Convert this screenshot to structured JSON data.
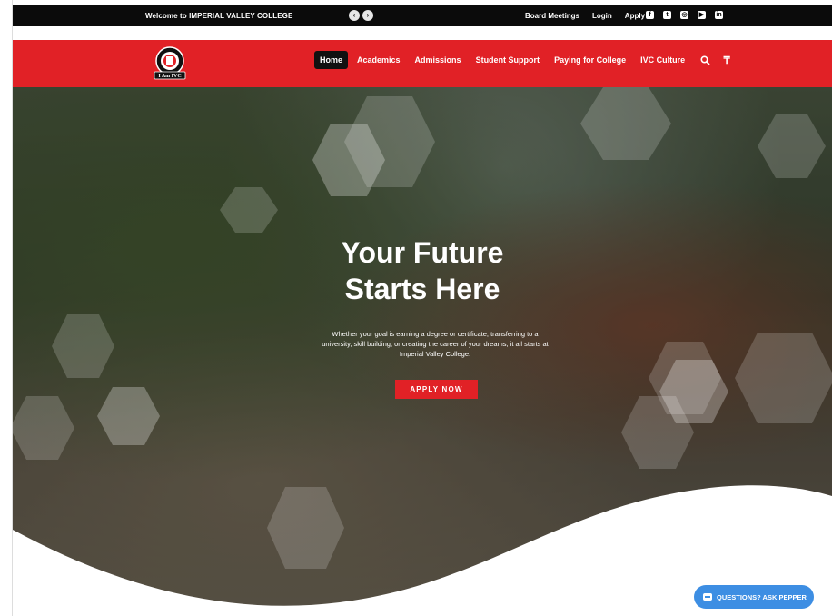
{
  "topbar": {
    "welcome": "Welcome to IMPERIAL VALLEY COLLEGE",
    "prev_arrow": "‹",
    "next_arrow": "›",
    "links": [
      "Board Meetings",
      "Login",
      "Apply"
    ],
    "social_icons": [
      "facebook-icon",
      "twitter-icon",
      "instagram-icon",
      "youtube-icon",
      "linkedin-icon"
    ]
  },
  "navbar": {
    "logo_text": "I Am IVC",
    "items": [
      "Home",
      "Academics",
      "Admissions",
      "Student Support",
      "Paying for College",
      "IVC Culture"
    ],
    "active": "Home",
    "search_icon": "⚲",
    "extra_icon": "₸"
  },
  "hero": {
    "headline_line1": "Your Future",
    "headline_line2": "Starts Here",
    "subtext": "Whether your goal is earning a degree or certificate, transferring to a university, skill building, or creating the career of your dreams, it all starts at Imperial Valley College.",
    "apply_button": "APPLY NOW"
  },
  "chat": {
    "label": "QUESTIONS? ASK PEPPER"
  },
  "colors": {
    "brand_red": "#e12126",
    "topbar_bg": "#0b0b0b",
    "chat_blue": "#3d8ee3"
  }
}
